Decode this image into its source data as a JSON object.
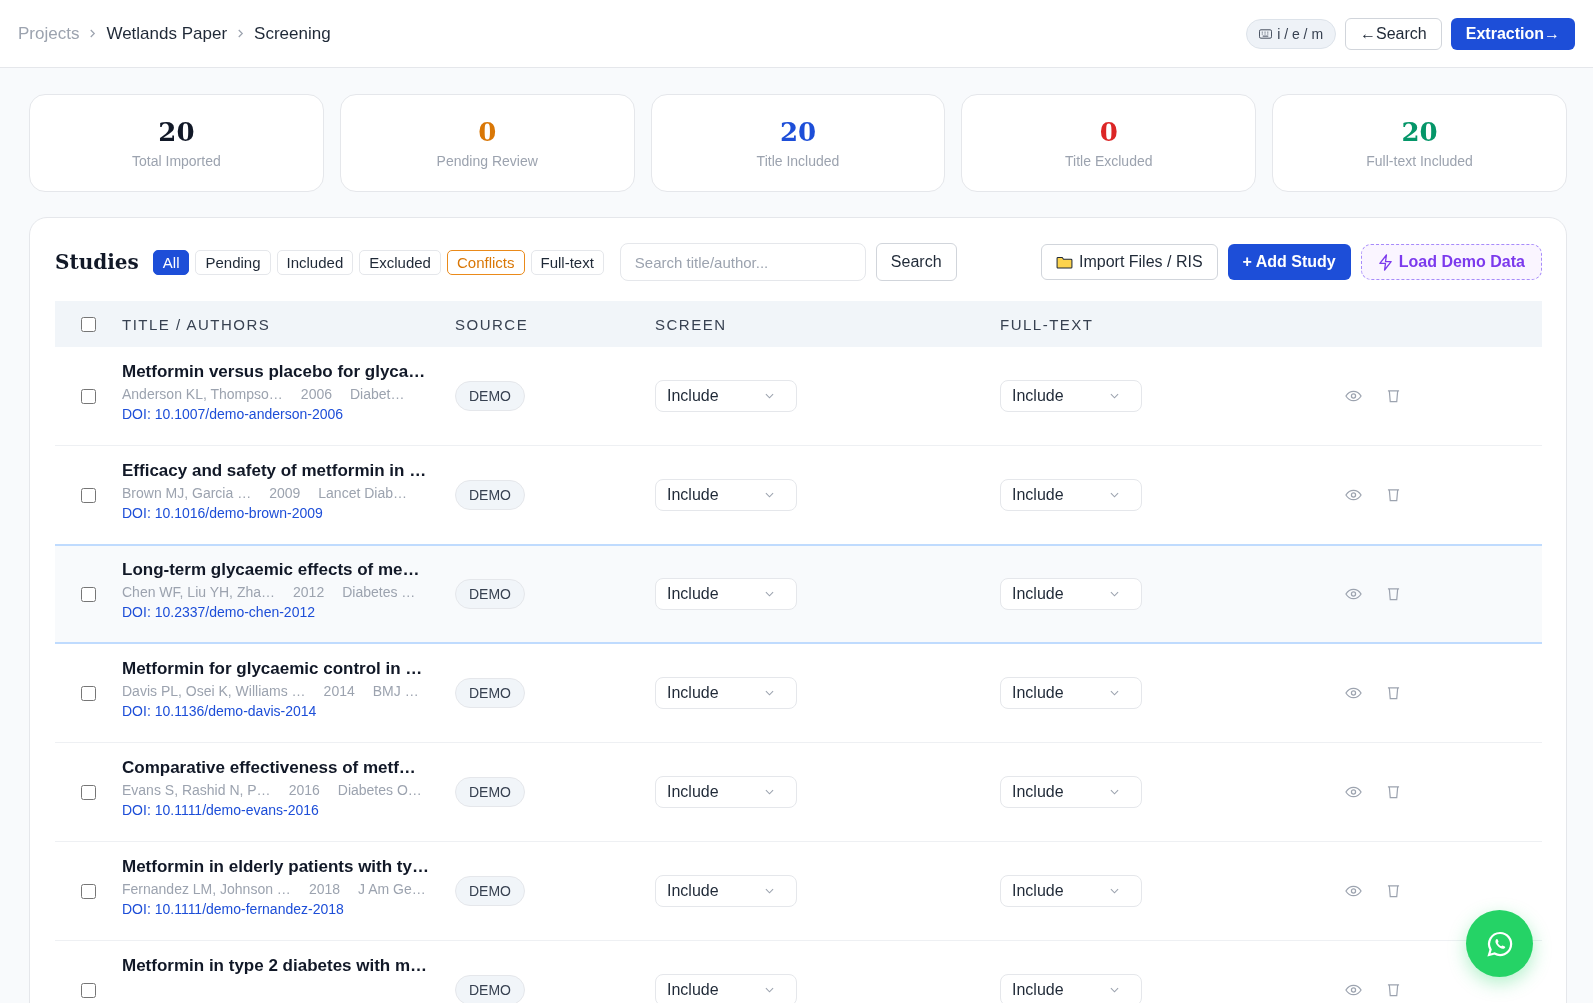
{
  "breadcrumb": [
    {
      "label": "Projects",
      "current": false
    },
    {
      "label": "Wetlands Paper",
      "current": true
    },
    {
      "label": "Screening",
      "current": true
    }
  ],
  "header_actions": {
    "shortcuts": "i / e / m",
    "back": "←Search",
    "next": "Extraction→"
  },
  "stats": [
    {
      "value": "20",
      "label": "Total Imported",
      "color": "#111827"
    },
    {
      "value": "0",
      "label": "Pending Review",
      "color": "#d97706"
    },
    {
      "value": "20",
      "label": "Title Included",
      "color": "#1d4ed8"
    },
    {
      "value": "0",
      "label": "Title Excluded",
      "color": "#dc2626"
    },
    {
      "value": "20",
      "label": "Full-text Included",
      "color": "#059669"
    }
  ],
  "studies": {
    "title": "Studies",
    "filters": [
      {
        "label": "All",
        "selected": true,
        "kind": "plain"
      },
      {
        "label": "Pending",
        "selected": false,
        "kind": "plain"
      },
      {
        "label": "Included",
        "selected": false,
        "kind": "plain"
      },
      {
        "label": "Excluded",
        "selected": false,
        "kind": "plain"
      },
      {
        "label": "Conflicts",
        "selected": false,
        "kind": "conflict"
      },
      {
        "label": "Full-text",
        "selected": false,
        "kind": "plain"
      }
    ],
    "search": {
      "placeholder": "Search title/author...",
      "button": "Search"
    },
    "import": "Import Files / RIS",
    "add": "+ Add Study",
    "demo": "Load Demo Data",
    "columns": [
      "TITLE / AUTHORS",
      "SOURCE",
      "SCREEN",
      "FULL-TEXT"
    ],
    "header_checked": false,
    "rows": [
      {
        "title": "Metformin versus placebo for glyca…",
        "authors": "Anderson KL, Thompso…",
        "year": "2006",
        "journal": "Diabet…",
        "doi": "DOI: 10.1007/demo-anderson-2006",
        "source": "DEMO",
        "screen": "Include",
        "fulltext": "Include",
        "checked": false,
        "selected": false
      },
      {
        "title": "Efficacy and safety of metformin in …",
        "authors": "Brown MJ, Garcia …",
        "year": "2009",
        "journal": "Lancet Diab…",
        "doi": "DOI: 10.1016/demo-brown-2009",
        "source": "DEMO",
        "screen": "Include",
        "fulltext": "Include",
        "checked": false,
        "selected": false
      },
      {
        "title": "Long-term glycaemic effects of me…",
        "authors": "Chen WF, Liu YH, Zha…",
        "year": "2012",
        "journal": "Diabetes …",
        "doi": "DOI: 10.2337/demo-chen-2012",
        "source": "DEMO",
        "screen": "Include",
        "fulltext": "Include",
        "checked": false,
        "selected": true
      },
      {
        "title": "Metformin for glycaemic control in …",
        "authors": "Davis PL, Osei K, Williams …",
        "year": "2014",
        "journal": "BMJ …",
        "doi": "DOI: 10.1136/demo-davis-2014",
        "source": "DEMO",
        "screen": "Include",
        "fulltext": "Include",
        "checked": false,
        "selected": false
      },
      {
        "title": "Comparative effectiveness of metf…",
        "authors": "Evans S, Rashid N, P…",
        "year": "2016",
        "journal": "Diabetes O…",
        "doi": "DOI: 10.1111/demo-evans-2016",
        "source": "DEMO",
        "screen": "Include",
        "fulltext": "Include",
        "checked": false,
        "selected": false
      },
      {
        "title": "Metformin in elderly patients with ty…",
        "authors": "Fernandez LM, Johnson …",
        "year": "2018",
        "journal": "J Am Ge…",
        "doi": "DOI: 10.1111/demo-fernandez-2018",
        "source": "DEMO",
        "screen": "Include",
        "fulltext": "Include",
        "checked": false,
        "selected": false
      },
      {
        "title": "Metformin in type 2 diabetes with m…",
        "source": "DEMO",
        "screen": "Include",
        "fulltext": "Include",
        "checked": false,
        "selected": false
      }
    ]
  }
}
